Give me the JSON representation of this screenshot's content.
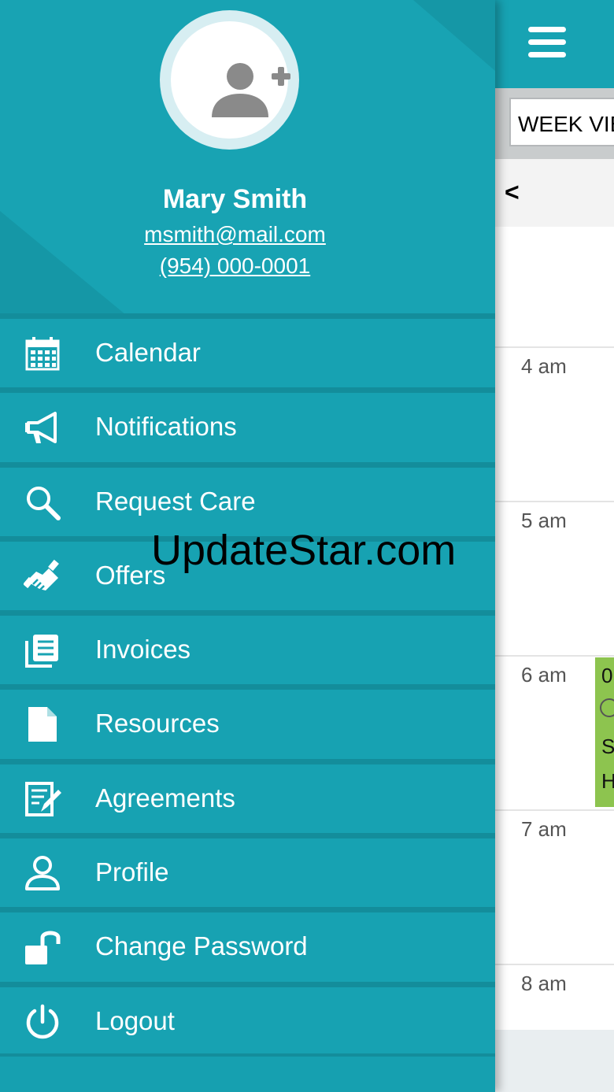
{
  "colors": {
    "primary": "#18a3b3",
    "primary_dark": "#138d9b",
    "event_green": "#8dc44f"
  },
  "user": {
    "name": "Mary Smith",
    "email": "msmith@mail.com",
    "phone": "(954) 000-0001"
  },
  "menu": [
    {
      "label": "Calendar",
      "icon": "calendar-icon"
    },
    {
      "label": "Notifications",
      "icon": "megaphone-icon"
    },
    {
      "label": "Request Care",
      "icon": "search-icon"
    },
    {
      "label": "Offers",
      "icon": "handshake-icon"
    },
    {
      "label": "Invoices",
      "icon": "invoices-icon"
    },
    {
      "label": "Resources",
      "icon": "document-icon"
    },
    {
      "label": "Agreements",
      "icon": "agreement-icon"
    },
    {
      "label": "Profile",
      "icon": "user-icon"
    },
    {
      "label": "Change Password",
      "icon": "unlock-icon"
    },
    {
      "label": "Logout",
      "icon": "power-icon"
    }
  ],
  "calendar": {
    "view_select": "WEEK VIE",
    "prev": "<",
    "times": [
      "4 am",
      "5 am",
      "6 am",
      "7 am",
      "8 am"
    ],
    "event_lines": [
      "0",
      "S",
      "H"
    ]
  },
  "watermark": "UpdateStar.com"
}
